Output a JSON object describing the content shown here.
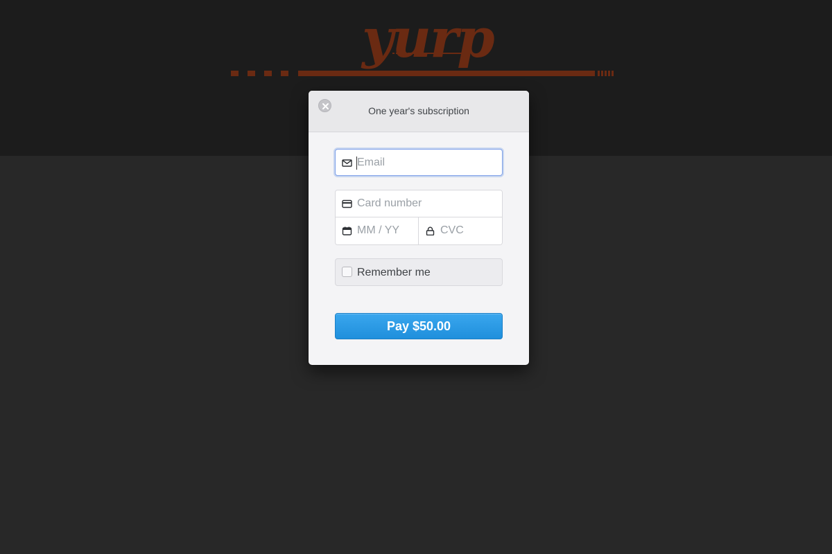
{
  "site": {
    "logo_text": "yurp",
    "logo_color": "#6a2a12"
  },
  "checkout": {
    "title": "One year's subscription",
    "close_icon": "close-icon",
    "email": {
      "placeholder": "Email",
      "value": "",
      "icon": "mail-icon",
      "focused": true
    },
    "card_number": {
      "placeholder": "Card number",
      "value": "",
      "icon": "credit-card-icon"
    },
    "expiry": {
      "placeholder": "MM / YY",
      "value": "",
      "icon": "calendar-icon"
    },
    "cvc": {
      "placeholder": "CVC",
      "value": "",
      "icon": "lock-icon"
    },
    "remember_me": {
      "label": "Remember me",
      "checked": false
    },
    "pay_button": {
      "label": "Pay $50.00",
      "color": "#2a9be6"
    }
  },
  "colors": {
    "header_band": "#1c1c1c",
    "page_background": "#282828",
    "accent_rust": "#6a2a12"
  }
}
